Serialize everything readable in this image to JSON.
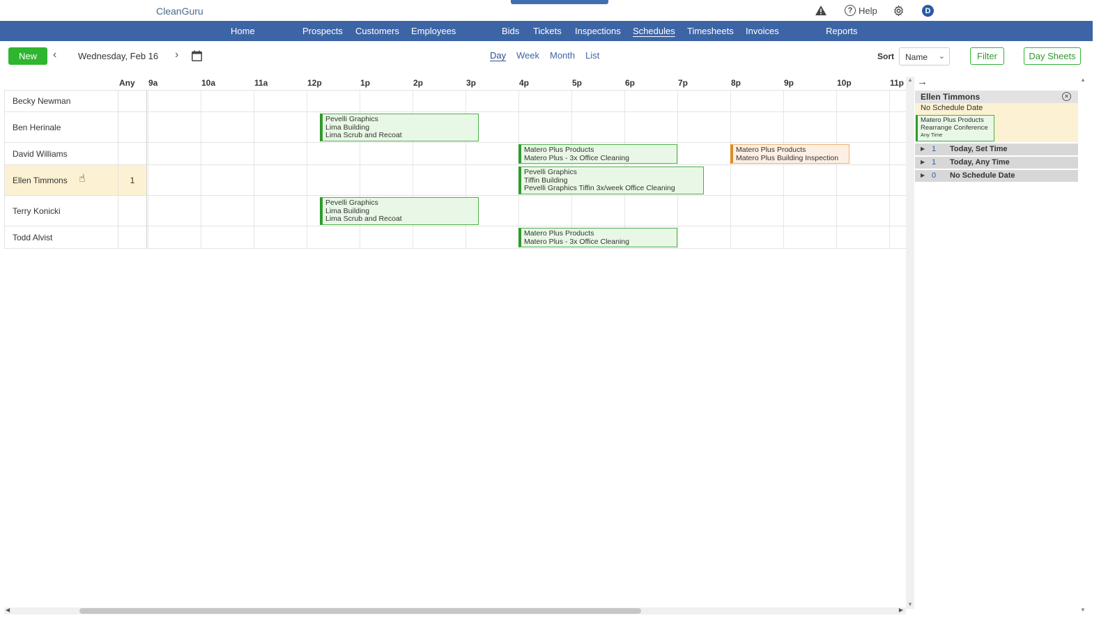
{
  "app": {
    "logo": "CleanGuru",
    "help_label": "Help",
    "avatar_initial": "D"
  },
  "nav": {
    "items": [
      "Home",
      "Prospects",
      "Customers",
      "Employees",
      "Bids",
      "Tickets",
      "Inspections",
      "Schedules",
      "Timesheets",
      "Invoices",
      "Reports"
    ],
    "active": "Schedules"
  },
  "toolbar": {
    "new_label": "New",
    "date": "Wednesday, Feb 16",
    "views": [
      "Day",
      "Week",
      "Month",
      "List"
    ],
    "active_view": "Day",
    "sort_label": "Sort",
    "sort_value": "Name",
    "filter_label": "Filter",
    "day_sheets_label": "Day Sheets"
  },
  "schedule": {
    "any_label": "Any",
    "hours": [
      "9a",
      "10a",
      "11a",
      "12p",
      "1p",
      "2p",
      "3p",
      "4p",
      "5p",
      "6p",
      "7p",
      "8p",
      "9p",
      "10p",
      "11p"
    ],
    "employees": [
      {
        "name": "Becky Newman",
        "any": "",
        "highlighted": false
      },
      {
        "name": "Ben Herinale",
        "any": "",
        "highlighted": false
      },
      {
        "name": "David Williams",
        "any": "",
        "highlighted": false
      },
      {
        "name": "Ellen Timmons",
        "any": "1",
        "highlighted": true
      },
      {
        "name": "Terry Konicki",
        "any": "",
        "highlighted": false
      },
      {
        "name": "Todd Alvist",
        "any": "",
        "highlighted": false
      }
    ],
    "events": [
      {
        "row": 1,
        "start_hour": 12.25,
        "end_hour": 15.25,
        "status": "scheduled",
        "lines": [
          "Pevelli Graphics",
          "Lima Building",
          "Lima Scrub and Recoat"
        ]
      },
      {
        "row": 2,
        "start_hour": 16.0,
        "end_hour": 19.0,
        "status": "scheduled",
        "lines": [
          "Matero Plus Products",
          "Matero Plus - 3x Office Cleaning"
        ]
      },
      {
        "row": 2,
        "start_hour": 20.0,
        "end_hour": 22.25,
        "status": "pending",
        "lines": [
          "Matero Plus Products",
          "Matero Plus Building Inspection"
        ]
      },
      {
        "row": 3,
        "start_hour": 16.0,
        "end_hour": 19.5,
        "status": "scheduled",
        "lines": [
          "Pevelli Graphics",
          "Tiffin Building",
          "Pevelli Graphics Tiffin 3x/week Office Cleaning"
        ]
      },
      {
        "row": 4,
        "start_hour": 12.25,
        "end_hour": 15.25,
        "status": "scheduled",
        "lines": [
          "Pevelli Graphics",
          "Lima Building",
          "Lima Scrub and Recoat"
        ]
      },
      {
        "row": 5,
        "start_hour": 16.0,
        "end_hour": 19.0,
        "status": "scheduled",
        "lines": [
          "Matero Plus Products",
          "Matero Plus - 3x Office Cleaning"
        ]
      }
    ]
  },
  "side_panel": {
    "employee": "Ellen Timmons",
    "section_label": "No Schedule Date",
    "card": {
      "line1": "Matero Plus Products",
      "line2": "Rearrange Conference",
      "line3": "Any Time"
    },
    "groups": [
      {
        "count": "1",
        "label": "Today, Set Time"
      },
      {
        "count": "1",
        "label": "Today, Any Time"
      },
      {
        "count": "0",
        "label": "No Schedule Date"
      }
    ]
  },
  "colors": {
    "nav_bg": "#3d65a6",
    "new_button": "#2fb52f",
    "event_green": "#2e9b2e",
    "event_orange": "#e08a20",
    "highlight_row": "#fcf1d2"
  }
}
